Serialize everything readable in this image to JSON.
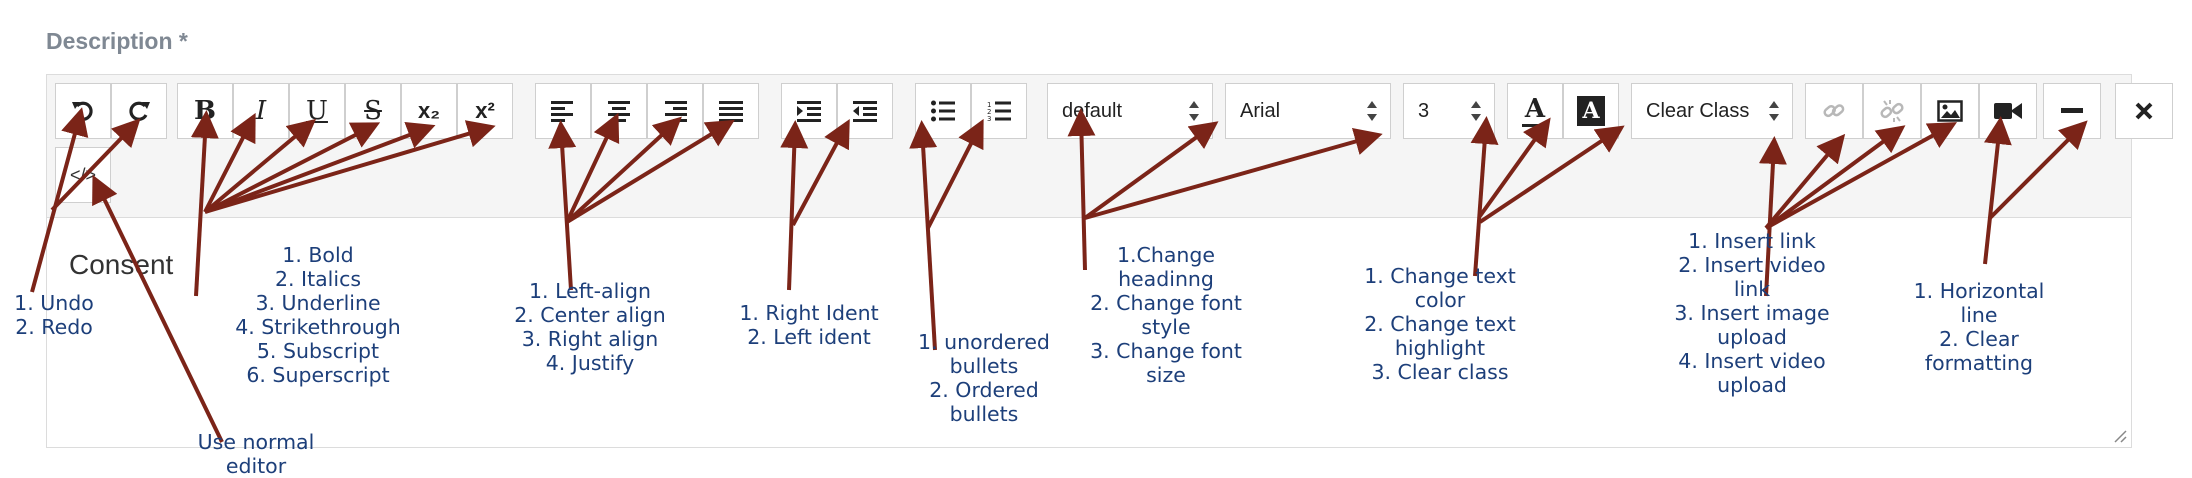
{
  "form": {
    "label": "Description *"
  },
  "toolbar": {
    "undo_icon": "undo-icon",
    "redo_icon": "redo-icon",
    "bold_label": "B",
    "italic_label": "I",
    "underline_label": "U",
    "strike_label": "S",
    "subscript_label": "x₂",
    "superscript_label": "x²",
    "heading_select": "default",
    "font_select": "Arial",
    "size_select": "3",
    "text_color_label": "A",
    "highlight_label": "A",
    "clear_class_select": "Clear Class",
    "code_view_label": "</>"
  },
  "content": {
    "text": "Consent"
  },
  "annotations": {
    "undo_redo": [
      "1. Undo",
      "2. Redo"
    ],
    "text_style": [
      "1. Bold",
      "2. Italics",
      "3. Underline",
      "4. Strikethrough",
      "5. Subscript",
      "6. Superscript"
    ],
    "alignment": [
      "1. Left-align",
      "2. Center align",
      "3. Right align",
      "4. Justify"
    ],
    "indent": [
      "1. Right Ident",
      "2. Left ident"
    ],
    "bullets": [
      "1. unordered",
      "bullets",
      "2. Ordered",
      "bullets"
    ],
    "font": [
      "1.Change",
      "headinng",
      "2. Change font",
      "style",
      "3. Change font",
      "size"
    ],
    "color": [
      "1. Change text",
      "color",
      "2. Change text",
      "highlight",
      "3. Clear class"
    ],
    "insert": [
      "1. Insert link",
      "2. Insert video",
      "link",
      "3. Insert image",
      "upload",
      "4. Insert video",
      "upload"
    ],
    "misc": [
      "1. Horizontal",
      "line",
      "2. Clear",
      "formatting"
    ],
    "code": [
      "Use normal",
      "editor"
    ]
  },
  "colors": {
    "arrow": "#7b2418",
    "annotation_text": "#1d3f7a",
    "label": "#7f8893"
  }
}
